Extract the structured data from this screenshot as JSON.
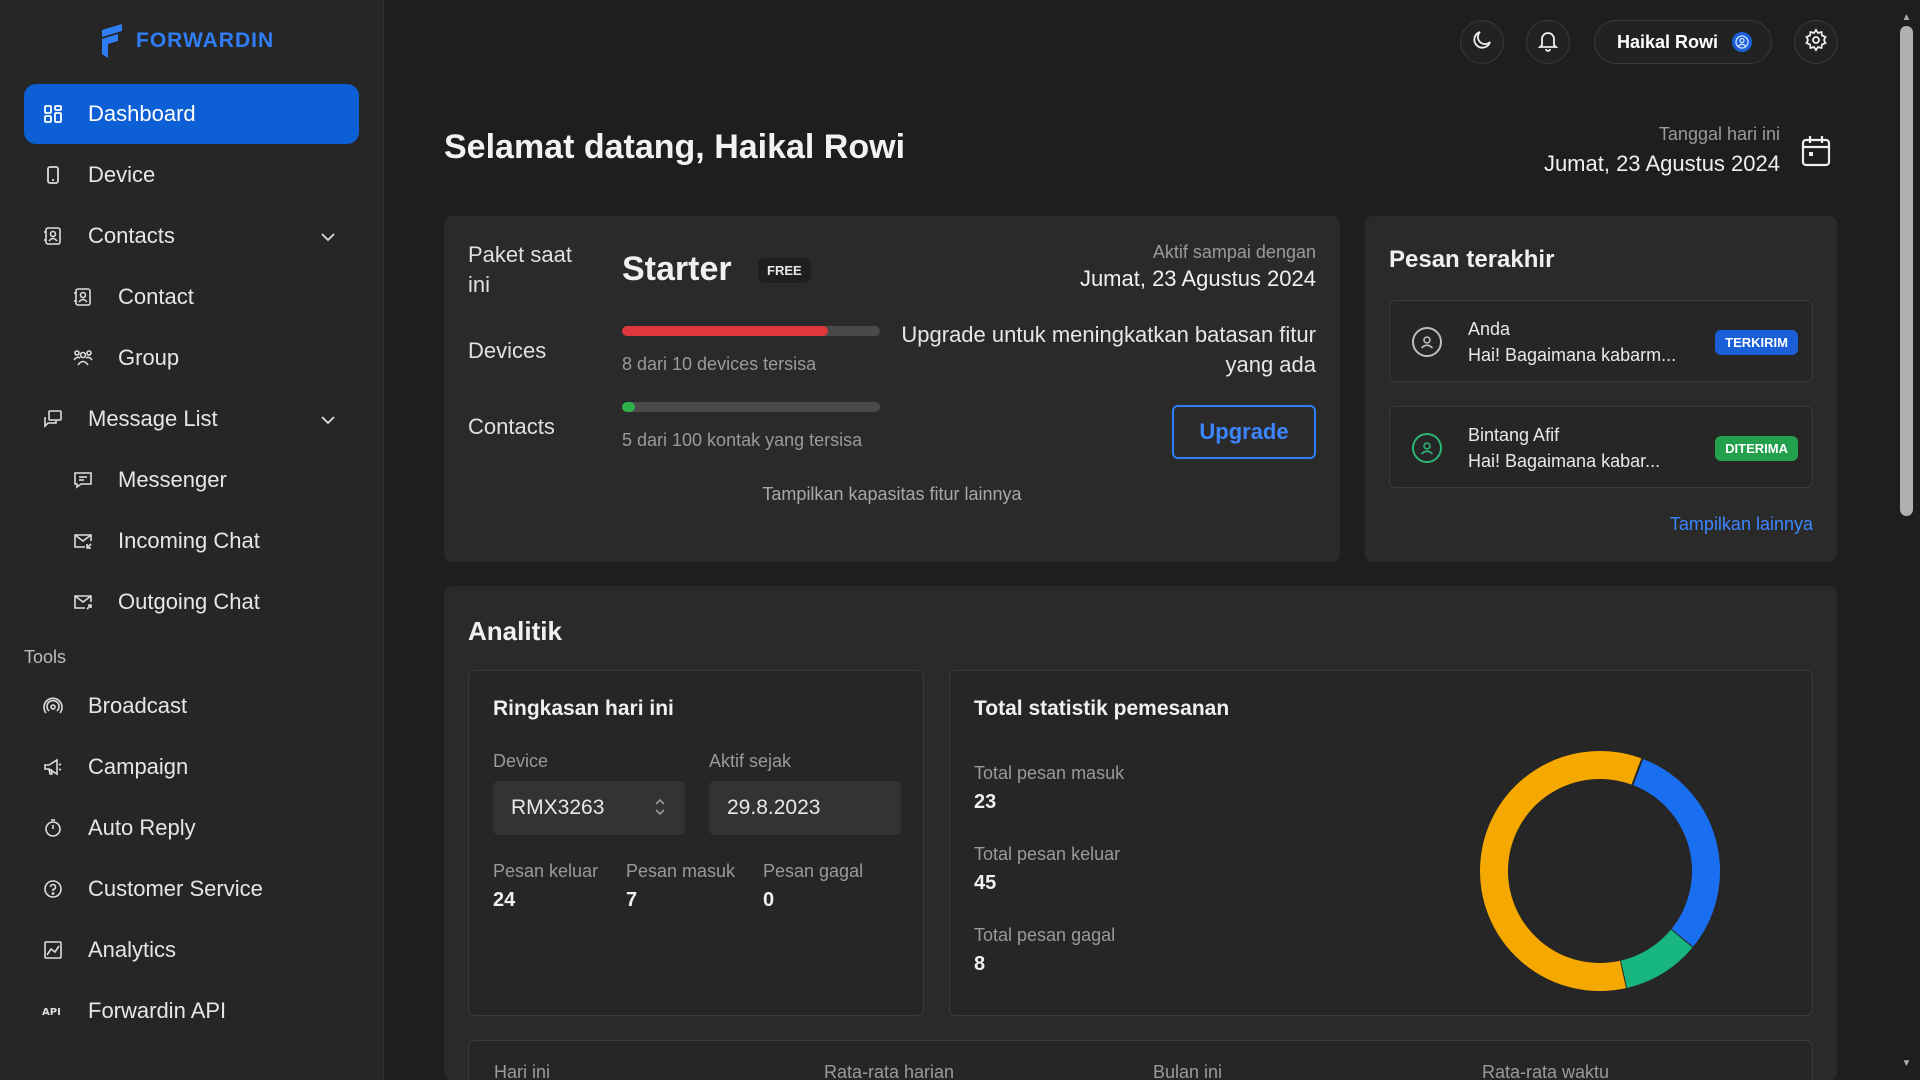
{
  "brand": {
    "name": "FORWARDIN",
    "color": "#2f7ef5"
  },
  "sidebar": {
    "items": [
      {
        "label": "Dashboard",
        "icon": "grid-icon",
        "active": true
      },
      {
        "label": "Device",
        "icon": "phone-icon"
      },
      {
        "label": "Contacts",
        "icon": "contacts-icon",
        "expandable": true
      },
      {
        "label": "Contact",
        "icon": "contact-card-icon",
        "sub": true
      },
      {
        "label": "Group",
        "icon": "group-icon",
        "sub": true
      },
      {
        "label": "Message List",
        "icon": "messages-icon",
        "expandable": true
      },
      {
        "label": "Messenger",
        "icon": "chat-icon",
        "sub": true
      },
      {
        "label": "Incoming Chat",
        "icon": "mail-in-icon",
        "sub": true
      },
      {
        "label": "Outgoing Chat",
        "icon": "mail-out-icon",
        "sub": true
      }
    ],
    "tools_label": "Tools",
    "tools": [
      {
        "label": "Broadcast",
        "icon": "broadcast-icon"
      },
      {
        "label": "Campaign",
        "icon": "megaphone-icon"
      },
      {
        "label": "Auto Reply",
        "icon": "timer-icon"
      },
      {
        "label": "Customer Service",
        "icon": "help-icon"
      },
      {
        "label": "Analytics",
        "icon": "chart-icon"
      },
      {
        "label": "Forwardin API",
        "icon": "api-icon"
      }
    ]
  },
  "topbar": {
    "user_name": "Haikal Rowi"
  },
  "header": {
    "welcome": "Selamat datang, Haikal Rowi",
    "date_label": "Tanggal hari ini",
    "date_value": "Jumat, 23 Agustus 2024"
  },
  "plan": {
    "label_line1": "Paket saat",
    "label_line2": "ini",
    "name": "Starter",
    "badge": "FREE",
    "devices_label": "Devices",
    "devices_text": "8 dari 10 devices tersisa",
    "devices_fraction": 0.8,
    "contacts_label": "Contacts",
    "contacts_text": "5 dari 100 kontak yang tersisa",
    "contacts_fraction": 0.05,
    "active_until_label": "Aktif sampai dengan",
    "active_until_date": "Jumat, 23 Agustus 2024",
    "upgrade_text": "Upgrade untuk meningkatkan batasan fitur yang ada",
    "upgrade_button": "Upgrade",
    "show_more": "Tampilkan kapasitas fitur lainnya"
  },
  "messages": {
    "title": "Pesan terakhir",
    "items": [
      {
        "name": "Anda",
        "text": "Hai! Bagaimana kabarm...",
        "badge": "TERKIRIM",
        "badge_color": "#1b5fd8"
      },
      {
        "name": "Bintang Afif",
        "text": "Hai! Bagaimana kabar...",
        "badge": "DITERIMA",
        "badge_color": "#22a04b"
      }
    ],
    "show_more": "Tampilkan lainnya"
  },
  "analytics": {
    "title": "Analitik",
    "summary": {
      "title": "Ringkasan hari ini",
      "device_label": "Device",
      "device_value": "RMX3263",
      "active_since_label": "Aktif sejak",
      "active_since_value": "29.8.2023",
      "out_label": "Pesan keluar",
      "out_value": "24",
      "in_label": "Pesan masuk",
      "in_value": "7",
      "fail_label": "Pesan gagal",
      "fail_value": "0"
    },
    "totals": {
      "title": "Total statistik pemesanan",
      "in_label": "Total pesan masuk",
      "in_value": "23",
      "out_label": "Total pesan keluar",
      "out_value": "45",
      "fail_label": "Total pesan gagal",
      "fail_value": "8"
    },
    "bottom_labels": [
      "Hari ini",
      "Rata-rata harian",
      "Bulan ini",
      "Rata-rata waktu"
    ]
  },
  "chart_data": {
    "type": "pie",
    "donut": true,
    "values": [
      23,
      8,
      45
    ],
    "colors": [
      "#1a6ff0",
      "#17b57f",
      "#f5a800"
    ]
  }
}
